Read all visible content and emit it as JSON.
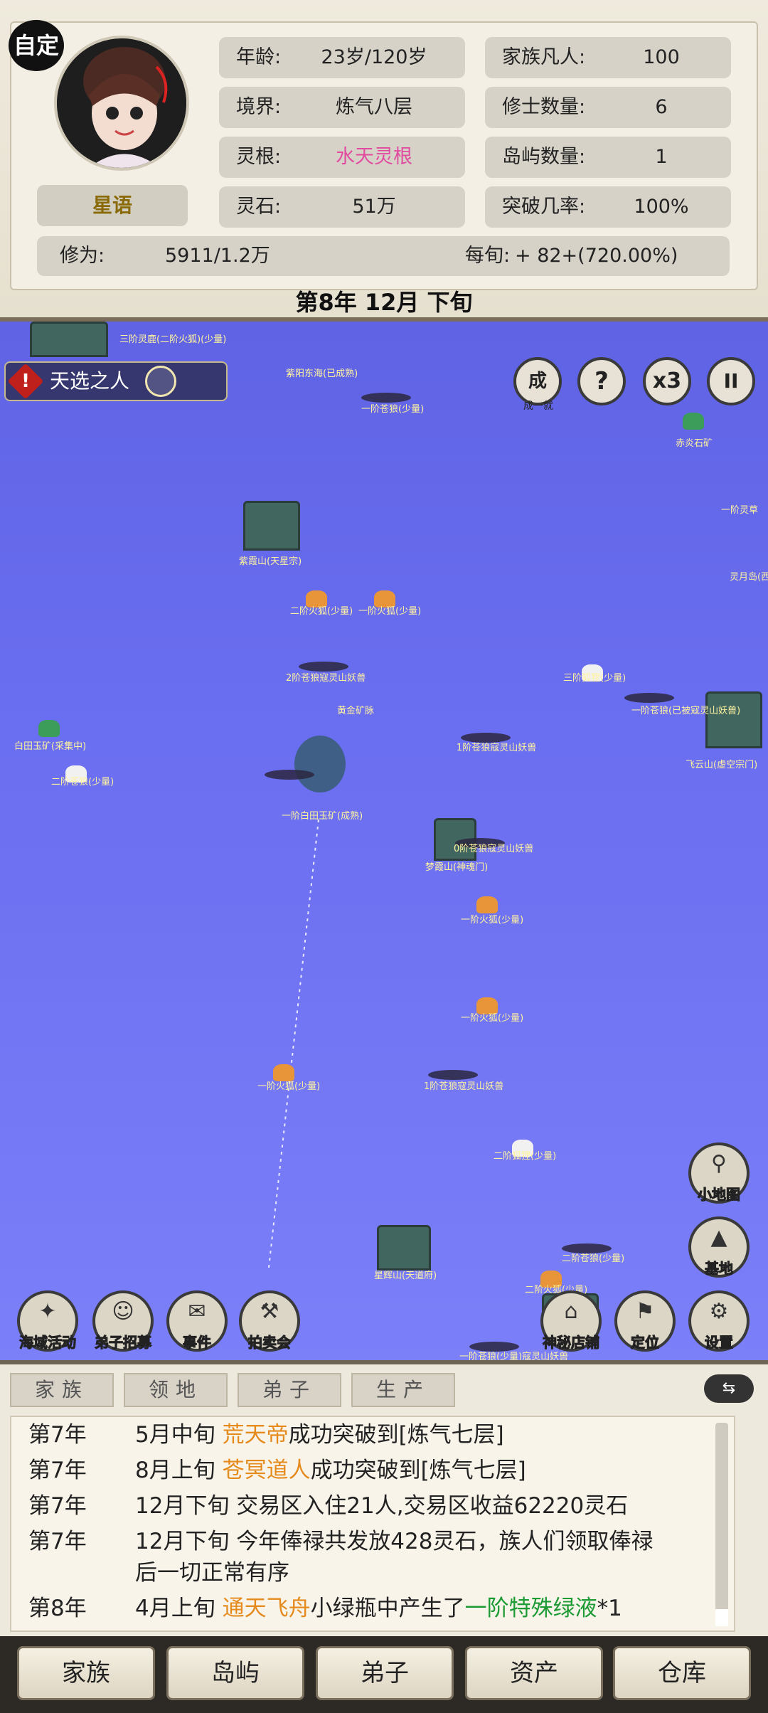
{
  "header": {
    "custom_badge": "自定",
    "character_name": "星语",
    "stats": {
      "age_label": "年龄:",
      "age_value": "23岁/120岁",
      "realm_label": "境界:",
      "realm_value": "炼气八层",
      "root_label": "灵根:",
      "root_value": "水天灵根",
      "stone_label": "灵石:",
      "stone_value": "51万",
      "family_label": "家族凡人:",
      "family_value": "100",
      "cultivator_label": "修士数量:",
      "cultivator_value": "6",
      "island_label": "岛屿数量:",
      "island_value": "1",
      "breakthrough_label": "突破几率:",
      "breakthrough_value": "100%",
      "cultivation_label": "修为:",
      "cultivation_value": "5911/1.2万",
      "per_period_label": "每旬:",
      "per_period_value": "+ 82+(720.00%)"
    },
    "date": "第8年 12月 下旬"
  },
  "map": {
    "chosen_one_label": "天选之人",
    "top_buttons": [
      {
        "label": "成",
        "caption": "成一就"
      },
      {
        "label": "?",
        "caption": ""
      },
      {
        "label": "x3",
        "caption": ""
      },
      {
        "label": "II",
        "caption": ""
      }
    ],
    "labels": [
      "三阶灵鹿(二阶火狐)(少量)",
      "紫阳东海(已成熟)",
      "一阶苍狼(少量)",
      "赤炎石矿",
      "一阶灵草",
      "灵月岛(西)",
      "紫霞山(天星宗)",
      "二阶火狐(少量)",
      "一阶火狐(少量)",
      "2阶苍狼寇灵山妖兽",
      "黄金矿脉",
      "三阶狐狸(少量)",
      "一阶苍狼(已被寇灵山妖兽)",
      "飞云山(虚空宗门)",
      "白田玉矿(采集中)",
      "二阶苍狼(少量)",
      "1阶苍狼寇灵山妖兽",
      "一阶白田玉矿(成熟)",
      "0阶苍狼寇灵山妖兽",
      "梦霞山(神魂门)",
      "一阶火狐(少量)",
      "一阶火狐(少量)",
      "一阶火狐(少量)",
      "1阶苍狼寇灵山妖兽",
      "二阶狐狸(少量)",
      "星辉山(天道府)",
      "二阶苍狼(少量)",
      "二阶火狐(少量)",
      "一阶苍狼(少量)寇灵山妖兽"
    ],
    "side_buttons": [
      {
        "icon": "pin-icon",
        "glyph": "⚲",
        "caption": "小地图"
      },
      {
        "icon": "mountain-icon",
        "glyph": "▲",
        "caption": "基地"
      }
    ],
    "bottom_buttons": [
      {
        "icon": "sea-event-icon",
        "glyph": "✦",
        "caption": "海域活动"
      },
      {
        "icon": "recruit-icon",
        "glyph": "☺",
        "caption": "弟子招募"
      },
      {
        "icon": "event-scroll-icon",
        "glyph": "✉",
        "caption": "事件"
      },
      {
        "icon": "auction-hammer-icon",
        "glyph": "⚒",
        "caption": "拍卖会"
      },
      {
        "icon": "mystic-shop-icon",
        "glyph": "⌂",
        "caption": "神秘店铺"
      },
      {
        "icon": "locate-flag-icon",
        "glyph": "⚑",
        "caption": "定位"
      },
      {
        "icon": "settings-gear-icon",
        "glyph": "⚙",
        "caption": "设置"
      }
    ]
  },
  "log": {
    "tabs": [
      "家族",
      "领地",
      "弟子",
      "生产"
    ],
    "toggle": "⇆",
    "entries": [
      {
        "year": "第7年",
        "pre": "5月中旬 ",
        "hl": "荒天帝",
        "hl_class": "orange",
        "post": "成功突破到[炼气七层]"
      },
      {
        "year": "第7年",
        "pre": "8月上旬 ",
        "hl": "苍冥道人",
        "hl_class": "orange",
        "post": "成功突破到[炼气七层]"
      },
      {
        "year": "第7年",
        "pre": "12月下旬 交易区入住21人,交易区收益62220灵石",
        "hl": "",
        "hl_class": "",
        "post": ""
      },
      {
        "year": "第7年",
        "pre": "12月下旬 今年俸禄共发放428灵石，族人们领取俸禄",
        "hl": "",
        "hl_class": "",
        "post": "",
        "cont": "后一切正常有序"
      },
      {
        "year": "第8年",
        "pre": "4月上旬 ",
        "hl": "通天飞舟",
        "hl_class": "orange",
        "post": "小绿瓶中产生了",
        "hl2": "一阶特殊绿液",
        "post2": "*1"
      }
    ]
  },
  "bottom_nav": [
    "家族",
    "岛屿",
    "弟子",
    "资产",
    "仓库"
  ]
}
